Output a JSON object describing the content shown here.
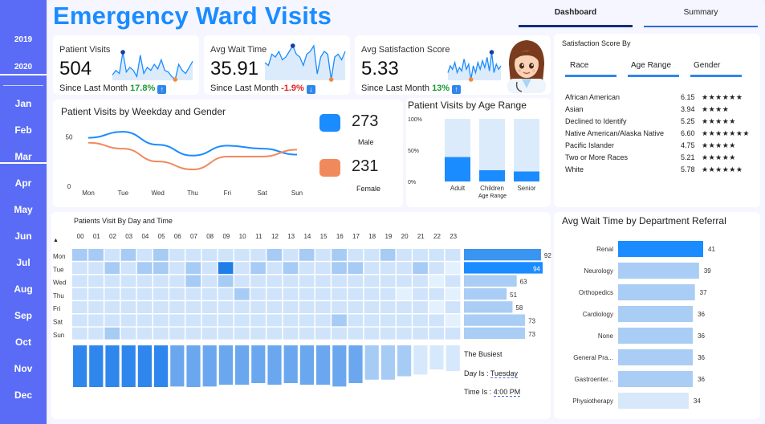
{
  "sidebar": {
    "years": [
      "2019",
      "2020"
    ],
    "selected_year": "2020",
    "months": [
      "Jan",
      "Feb",
      "Mar",
      "Apr",
      "May",
      "Jun",
      "Jul",
      "Aug",
      "Sep",
      "Oct",
      "Nov",
      "Dec"
    ],
    "selected_month": "Mar"
  },
  "header": {
    "title": "Emergency Ward Visits",
    "tabs": [
      "Dashboard",
      "Summary"
    ],
    "active_tab": "Dashboard"
  },
  "kpis": [
    {
      "label": "Patient Visits",
      "value": "504",
      "since_label": "Since Last Month",
      "change": "17.8%",
      "direction": "up"
    },
    {
      "label": "Avg Wait Time",
      "value": "35.91",
      "since_label": "Since Last Month",
      "change": "-1.9%",
      "direction": "down"
    },
    {
      "label": "Avg Satisfaction Score",
      "value": "5.33",
      "since_label": "Since Last Month",
      "change": "13%",
      "direction": "up"
    }
  ],
  "weekday_gender": {
    "title": "Patient Visits by Weekday and Gender",
    "male_count": "273",
    "male_label": "Male",
    "female_count": "231",
    "female_label": "Female",
    "colors": {
      "male": "#1a8cff",
      "female": "#f08a5d"
    }
  },
  "age_range": {
    "title": "Patient Visits by Age Range",
    "xlabel": "Age Range"
  },
  "satisfaction": {
    "title": "Satisfaction Score By",
    "tabs": [
      "Race",
      "Age Range",
      "Gender"
    ],
    "active_tab": "Race",
    "rows": [
      {
        "name": "African American",
        "score": "6.15",
        "stars": "★★★★★★"
      },
      {
        "name": "Asian",
        "score": "3.94",
        "stars": "★★★★"
      },
      {
        "name": "Declined to Identify",
        "score": "5.25",
        "stars": "★★★★★"
      },
      {
        "name": "Native American/Alaska Native",
        "score": "6.60",
        "stars": "★★★★★★★"
      },
      {
        "name": "Pacific Islander",
        "score": "4.75",
        "stars": "★★★★★"
      },
      {
        "name": "Two or More Races",
        "score": "5.21",
        "stars": "★★★★★"
      },
      {
        "name": "White",
        "score": "5.78",
        "stars": "★★★★★★"
      }
    ]
  },
  "heatmap": {
    "title": "Patients Visit By Day and Time",
    "sort_indicator": "▲",
    "busiest_label": "The Busiest",
    "day_label": "Day Is :",
    "day_value": "Tuesday",
    "time_label": "Time Is :",
    "time_value": "4:00 PM"
  },
  "wait_dept": {
    "title": "Avg Wait Time by Department Referral"
  },
  "chart_data": [
    {
      "type": "line",
      "title": "Patient Visits by Weekday and Gender",
      "categories": [
        "Mon",
        "Tue",
        "Wed",
        "Thu",
        "Fri",
        "Sat",
        "Sun"
      ],
      "series": [
        {
          "name": "Male",
          "values": [
            49,
            55,
            42,
            31,
            41,
            38,
            32
          ]
        },
        {
          "name": "Female",
          "values": [
            44,
            38,
            25,
            17,
            30,
            30,
            37
          ]
        }
      ],
      "ylim": [
        0,
        60
      ],
      "yticks": [
        0,
        50
      ]
    },
    {
      "type": "bar",
      "title": "Patient Visits by Age Range",
      "categories": [
        "Adult",
        "Children",
        "Senior"
      ],
      "values": [
        0.39,
        0.18,
        0.16
      ],
      "ylim": [
        0,
        1
      ],
      "yticks": [
        "0%",
        "50%",
        "100%"
      ],
      "xlabel": "Age Range"
    },
    {
      "type": "heatmap",
      "title": "Patients Visit By Day and Time",
      "x": [
        "00",
        "01",
        "02",
        "03",
        "04",
        "05",
        "06",
        "07",
        "08",
        "09",
        "10",
        "11",
        "12",
        "13",
        "14",
        "15",
        "16",
        "17",
        "18",
        "19",
        "20",
        "21",
        "22",
        "23"
      ],
      "y": [
        "Mon",
        "Tue",
        "Wed",
        "Thu",
        "Fri",
        "Sat",
        "Sun"
      ],
      "row_totals": [
        92,
        94,
        63,
        51,
        58,
        73,
        73
      ],
      "hour_totals": [
        30,
        30,
        28,
        27,
        26,
        27,
        24,
        25,
        24,
        23,
        23,
        22,
        23,
        22,
        23,
        23,
        24,
        22,
        20,
        20,
        18,
        17,
        14,
        15
      ],
      "values": [
        [
          2,
          2,
          1,
          2,
          1,
          2,
          1,
          1,
          1,
          1,
          1,
          1,
          2,
          1,
          2,
          1,
          2,
          1,
          1,
          2,
          1,
          1,
          1,
          1
        ],
        [
          1,
          1,
          2,
          1,
          2,
          2,
          1,
          2,
          1,
          4,
          1,
          2,
          1,
          2,
          1,
          1,
          2,
          2,
          1,
          1,
          1,
          2,
          1,
          0
        ],
        [
          1,
          1,
          1,
          1,
          1,
          1,
          1,
          2,
          1,
          2,
          1,
          1,
          1,
          1,
          1,
          1,
          1,
          1,
          1,
          1,
          1,
          1,
          0,
          1
        ],
        [
          1,
          1,
          1,
          1,
          1,
          1,
          1,
          1,
          1,
          1,
          2,
          1,
          1,
          1,
          1,
          1,
          1,
          1,
          1,
          1,
          0,
          1,
          1,
          0
        ],
        [
          1,
          1,
          1,
          1,
          1,
          1,
          1,
          1,
          1,
          1,
          1,
          1,
          1,
          1,
          1,
          1,
          1,
          1,
          1,
          1,
          1,
          1,
          0,
          1
        ],
        [
          1,
          1,
          1,
          1,
          1,
          1,
          1,
          1,
          1,
          1,
          1,
          1,
          1,
          1,
          1,
          1,
          2,
          1,
          1,
          1,
          1,
          1,
          1,
          0
        ],
        [
          1,
          1,
          2,
          1,
          1,
          1,
          1,
          1,
          1,
          1,
          1,
          1,
          1,
          1,
          1,
          1,
          1,
          1,
          1,
          1,
          1,
          1,
          1,
          1
        ]
      ]
    },
    {
      "type": "bar",
      "title": "Avg Wait Time by Department Referral",
      "categories": [
        "Renal",
        "Neurology",
        "Orthopedics",
        "Cardiology",
        "None",
        "General Pra...",
        "Gastroenter...",
        "Physiotherapy"
      ],
      "values": [
        41,
        39,
        37,
        36,
        36,
        36,
        36,
        34
      ]
    },
    {
      "type": "line",
      "title": "Patient Visits",
      "values": [
        15,
        18,
        16,
        30,
        17,
        20,
        18,
        14,
        28,
        16,
        20,
        18,
        22,
        19,
        25,
        18,
        17,
        14,
        12,
        22,
        18,
        16,
        20,
        24
      ]
    },
    {
      "type": "line",
      "title": "Avg Wait Time",
      "values": [
        34,
        33,
        37,
        36,
        38,
        35,
        36,
        38,
        40,
        37,
        36,
        33,
        37,
        38,
        40,
        30,
        36,
        38,
        37,
        28,
        36,
        37,
        35,
        38
      ]
    },
    {
      "type": "line",
      "title": "Avg Satisfaction Score",
      "values": [
        5.0,
        5.4,
        5.2,
        5.6,
        5.0,
        5.3,
        5.1,
        5.8,
        5.2,
        5.5,
        4.6,
        5.4,
        5.0,
        5.6,
        5.2,
        5.7,
        5.3,
        5.9,
        5.1,
        6.2,
        5.0,
        5.5,
        5.2,
        5.4
      ]
    }
  ]
}
